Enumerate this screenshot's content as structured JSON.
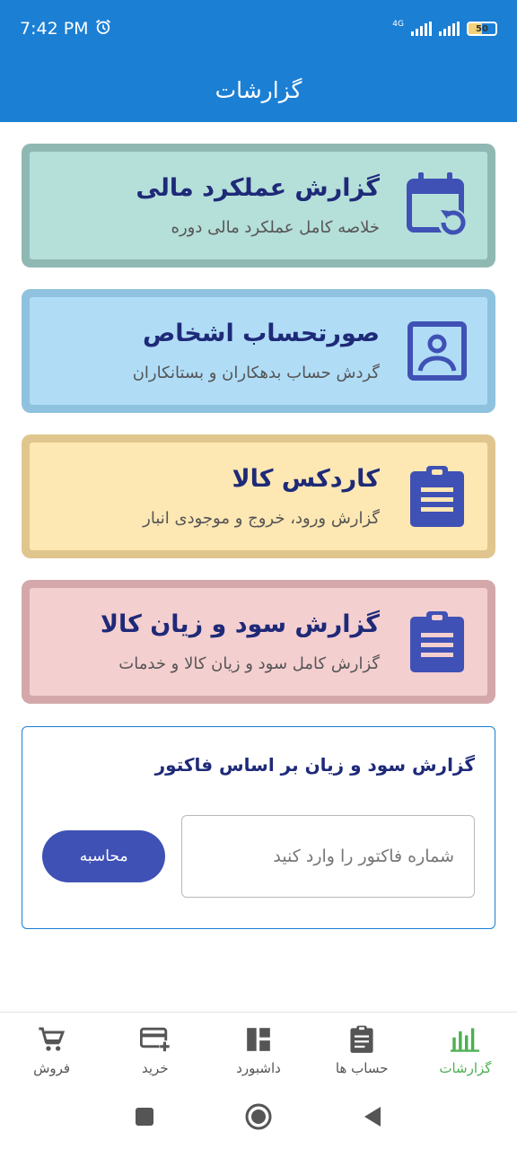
{
  "status": {
    "time": "7:42 PM",
    "network": "4G",
    "battery_level": "50"
  },
  "appbar": {
    "title": "گزارشات"
  },
  "cards": [
    {
      "title": "گزارش عملکرد مالی",
      "subtitle": "خلاصه کامل عملکرد مالی دوره",
      "bg": "#b5dfd9",
      "border": "#8fb8b2",
      "icon": "calendar-refresh-icon"
    },
    {
      "title": "صورتحساب اشخاص",
      "subtitle": "گردش حساب بدهکاران و بستانکاران",
      "bg": "#b0dcf6",
      "border": "#8ec2de",
      "icon": "account-box-icon"
    },
    {
      "title": "کاردکس کالا",
      "subtitle": "گزارش ورود، خروج و موجودی انبار",
      "bg": "#fde7b3",
      "border": "#e0c68e",
      "icon": "clipboard-text-icon"
    },
    {
      "title": "گزارش سود و زیان کالا",
      "subtitle": "گزارش کامل سود و زیان کالا و خدمات",
      "bg": "#f4cfd0",
      "border": "#d4a8aa",
      "icon": "clipboard-text-icon"
    }
  ],
  "invoice": {
    "title": "گزارش سود و زیان بر اساس فاکتور",
    "placeholder": "شماره فاکتور را وارد کنید",
    "button_label": "محاسبه"
  },
  "bottom_nav": [
    {
      "label": "فروش",
      "icon": "cart-icon",
      "active": false
    },
    {
      "label": "خرید",
      "icon": "card-plus-icon",
      "active": false
    },
    {
      "label": "داشبورد",
      "icon": "dashboard-icon",
      "active": false
    },
    {
      "label": "حساب ها",
      "icon": "clipboard-icon",
      "active": false
    },
    {
      "label": "گزارشات",
      "icon": "bar-chart-icon",
      "active": true
    }
  ],
  "colors": {
    "primary": "#1b7fd4",
    "icon": "#3f51b5",
    "title_text": "#1e2a78",
    "active_nav": "#4caf50"
  }
}
